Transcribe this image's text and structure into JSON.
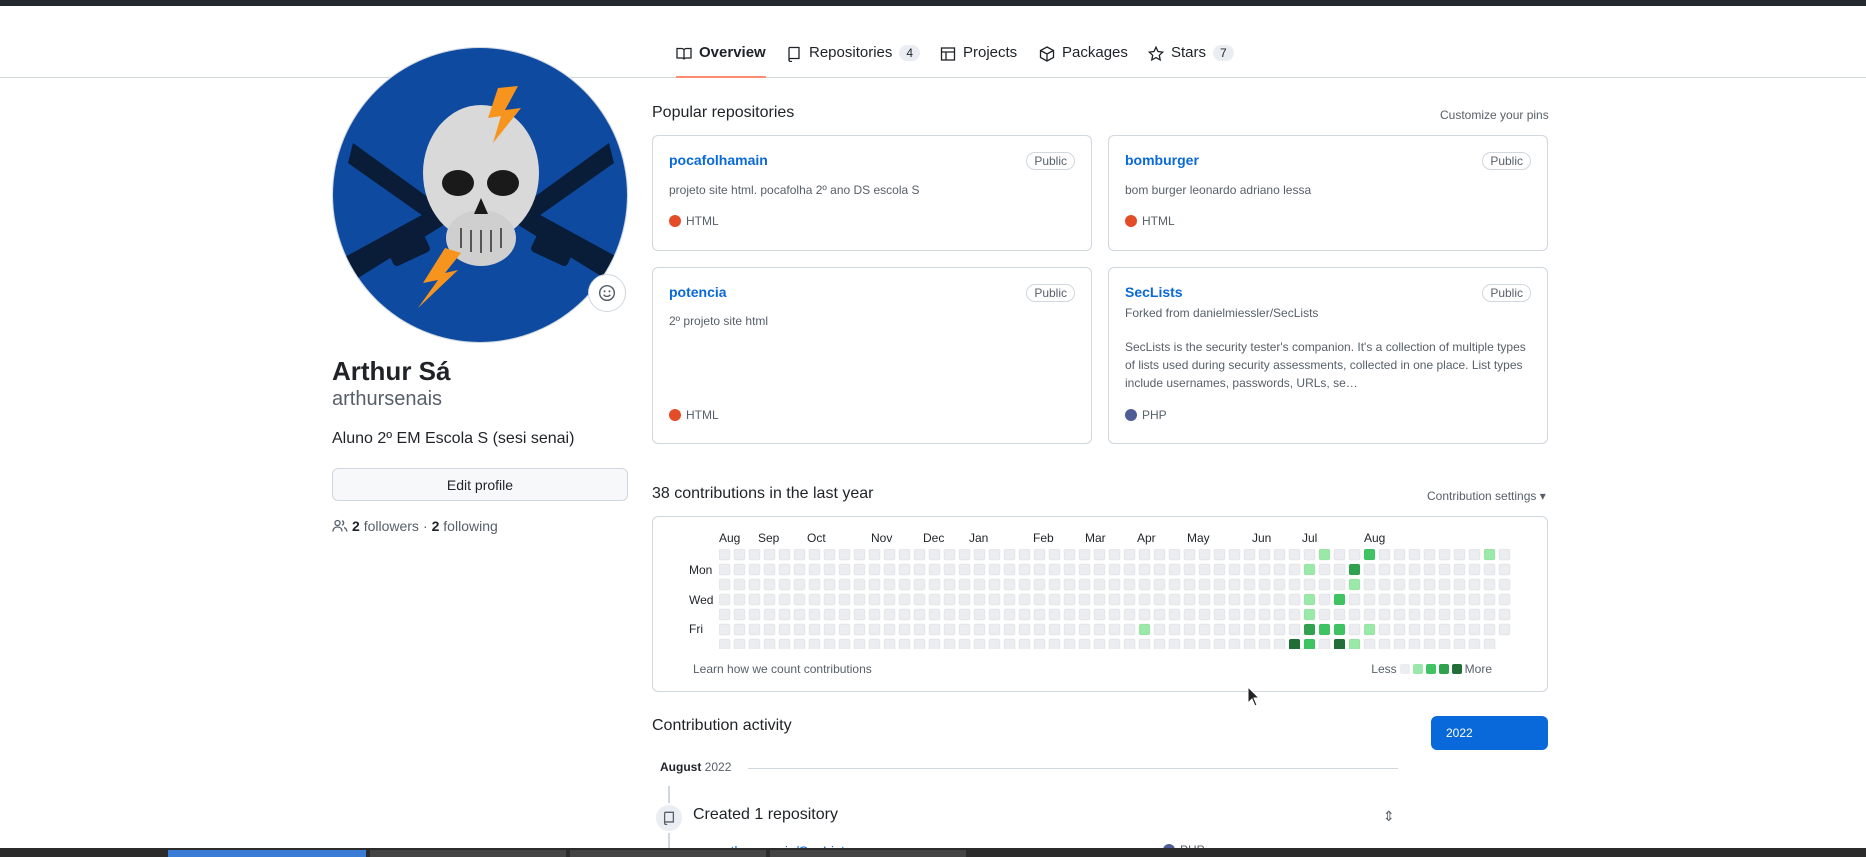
{
  "tabs": [
    {
      "label": "Overview",
      "icon": "book-icon"
    },
    {
      "label": "Repositories",
      "count": "4",
      "icon": "repo-icon"
    },
    {
      "label": "Projects",
      "icon": "table-icon"
    },
    {
      "label": "Packages",
      "icon": "package-icon"
    },
    {
      "label": "Stars",
      "count": "7",
      "icon": "star-icon"
    }
  ],
  "profile": {
    "name": "Arthur Sá",
    "login": "arthursenais",
    "bio": "Aluno 2º EM Escola S (sesi senai)",
    "edit_label": "Edit profile",
    "followers_count": "2",
    "followers_label": "followers",
    "separator": "·",
    "following_count": "2",
    "following_label": "following"
  },
  "popular": {
    "title": "Popular repositories",
    "customize": "Customize your pins",
    "repos": [
      {
        "name": "pocafolhamain",
        "badge": "Public",
        "description": "projeto site html. pocafolha 2º ano DS escola S",
        "language": "HTML",
        "lang_color": "#e34c26"
      },
      {
        "name": "bomburger",
        "badge": "Public",
        "description": "bom burger leonardo adriano lessa",
        "language": "HTML",
        "lang_color": "#e34c26"
      },
      {
        "name": "potencia",
        "badge": "Public",
        "description": "2º projeto site html",
        "language": "HTML",
        "lang_color": "#e34c26"
      },
      {
        "name": "SecLists",
        "badge": "Public",
        "forked": "Forked from danielmiessler/SecLists",
        "description": "SecLists is the security tester's companion. It's a collection of multiple types of lists used during security assessments, collected in one place. List types include usernames, passwords, URLs, se…",
        "language": "PHP",
        "lang_color": "#4F5D95"
      }
    ]
  },
  "contributions": {
    "title": "38 contributions in the last year",
    "settings": "Contribution settings ▾",
    "months": [
      "Aug",
      "Sep",
      "Oct",
      "Nov",
      "Dec",
      "Jan",
      "Feb",
      "Mar",
      "Apr",
      "May",
      "Jun",
      "Jul",
      "Aug"
    ],
    "days": [
      "Mon",
      "Wed",
      "Fri"
    ],
    "learn": "Learn how we count contributions",
    "less": "Less",
    "more": "More",
    "level_colors": [
      "#ebedf0",
      "#9be9a8",
      "#40c463",
      "#30a14e",
      "#216e39"
    ],
    "active_cells": [
      [
        38,
        6,
        4
      ],
      [
        39,
        1,
        1
      ],
      [
        39,
        3,
        1
      ],
      [
        39,
        4,
        1
      ],
      [
        39,
        5,
        3
      ],
      [
        39,
        6,
        2
      ],
      [
        40,
        0,
        1
      ],
      [
        40,
        5,
        2
      ],
      [
        41,
        3,
        2
      ],
      [
        41,
        5,
        2
      ],
      [
        41,
        6,
        4
      ],
      [
        42,
        1,
        3
      ],
      [
        42,
        2,
        1
      ],
      [
        42,
        6,
        1
      ],
      [
        43,
        0,
        2
      ],
      [
        43,
        5,
        1
      ],
      [
        51,
        0,
        1
      ],
      [
        28,
        5,
        1
      ]
    ]
  },
  "activity": {
    "title": "Contribution activity",
    "year": "2022",
    "month": "August",
    "month_year": "2022",
    "created": "Created 1 repository",
    "repo": "arthursenais/SecLists",
    "repo_lang": "PHP",
    "repo_lang_color": "#4F5D95"
  }
}
